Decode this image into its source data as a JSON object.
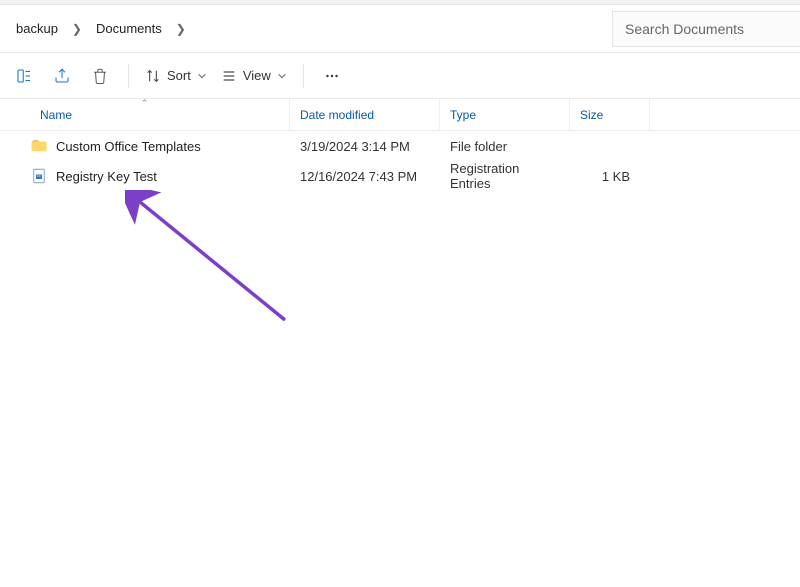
{
  "breadcrumb": {
    "items": [
      {
        "label": "backup"
      },
      {
        "label": "Documents"
      }
    ]
  },
  "search": {
    "placeholder": "Search Documents"
  },
  "toolbar": {
    "sort_label": "Sort",
    "view_label": "View"
  },
  "columns": {
    "name": "Name",
    "date": "Date modified",
    "type": "Type",
    "size": "Size"
  },
  "files": [
    {
      "icon": "folder",
      "name": "Custom Office Templates",
      "date": "3/19/2024 3:14 PM",
      "type": "File folder",
      "size": ""
    },
    {
      "icon": "reg",
      "name": "Registry Key Test",
      "date": "12/16/2024 7:43 PM",
      "type": "Registration Entries",
      "size": "1 KB"
    }
  ]
}
